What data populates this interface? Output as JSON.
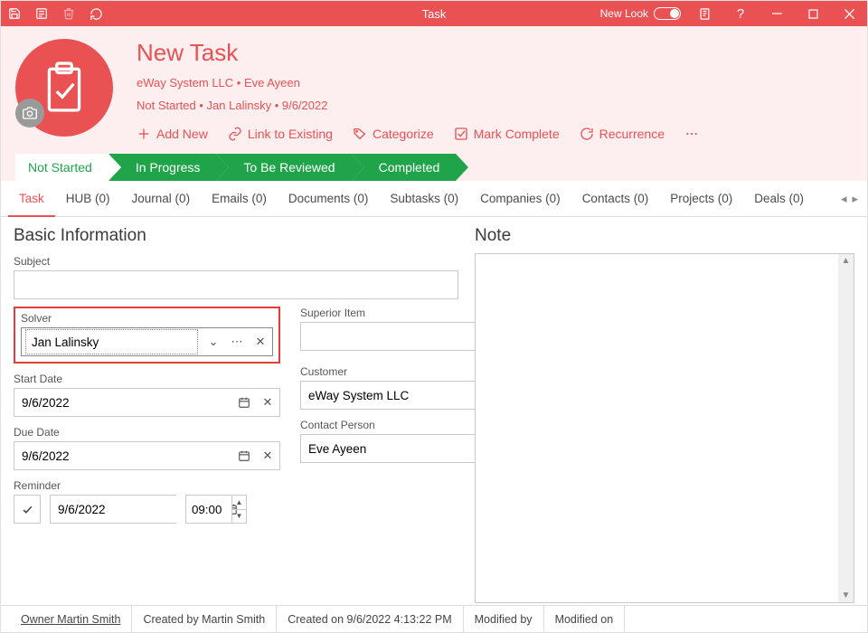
{
  "titlebar": {
    "title": "Task",
    "newlook_label": "New Look"
  },
  "header": {
    "title": "New Task",
    "breadcrumb": {
      "company": "eWay System LLC",
      "contact": "Eve Ayeen"
    },
    "statusline": {
      "status": "Not Started",
      "solver": "Jan Lalinsky",
      "date": "9/6/2022"
    },
    "actions": {
      "add": "Add New",
      "link": "Link to Existing",
      "categorize": "Categorize",
      "complete": "Mark Complete",
      "recurrence": "Recurrence"
    }
  },
  "stages": [
    "Not Started",
    "In Progress",
    "To Be Reviewed",
    "Completed"
  ],
  "tabs": [
    "Task",
    "HUB (0)",
    "Journal (0)",
    "Emails (0)",
    "Documents (0)",
    "Subtasks (0)",
    "Companies (0)",
    "Contacts (0)",
    "Projects (0)",
    "Deals (0)"
  ],
  "section_titles": {
    "basic": "Basic Information",
    "note": "Note"
  },
  "labels": {
    "subject": "Subject",
    "solver": "Solver",
    "superior": "Superior Item",
    "start": "Start Date",
    "customer": "Customer",
    "due": "Due Date",
    "contact": "Contact Person",
    "reminder": "Reminder"
  },
  "values": {
    "subject": "",
    "solver": "Jan Lalinsky",
    "superior": "",
    "start_date": "9/6/2022",
    "customer": "eWay System LLC",
    "due_date": "9/6/2022",
    "contact_person": "Eve Ayeen",
    "reminder_checked": true,
    "reminder_date": "9/6/2022",
    "reminder_time": "09:00",
    "note": ""
  },
  "footer": {
    "owner_label": "Owner Martin Smith",
    "created_by": "Created by Martin Smith",
    "created_on": "Created on 9/6/2022 4:13:22 PM",
    "modified_by": "Modified by",
    "modified_on": "Modified on"
  }
}
